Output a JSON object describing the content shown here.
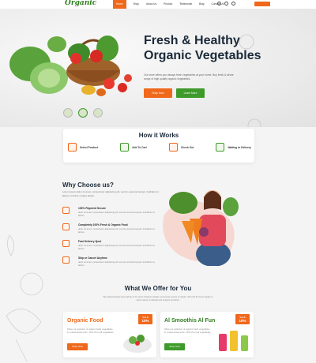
{
  "nav": {
    "logo": "Organic",
    "links": [
      "Home",
      "Shop",
      "About Us",
      "Product",
      "Testimonial",
      "Blog",
      "Contact Us"
    ],
    "active_index": 0
  },
  "hero": {
    "title_line1": "Fresh & Healthy",
    "title_line2": "Organic Vegetables",
    "description": "Our store offers you always fresh vegetables at your home. Buy fresh & whole range of high quality organic vegetables.",
    "shop_button": "Shop Now",
    "learn_button": "Learn More"
  },
  "how": {
    "title": "How  it Works",
    "steps": [
      "Select Product",
      "Add To Cart",
      "Check Out",
      "Waiting to Delivery"
    ]
  },
  "why": {
    "title": "Why Choose us?",
    "description": "Lorem ipsum dolor sit amet, consectetur adipiscing elit, sed do eiusmod tempor incididunt ut labore et dolore magna aliqua.",
    "features": [
      {
        "title": "100% Payment Secure",
        "desc": "dolor sit amet, consectetur adipiscing elit, sed do eiusmod tempor incididunt ut labore"
      },
      {
        "title": "Completely 100% Fresh & Organic Food",
        "desc": "dolor sit amet, consectetur adipiscing elit, sed do eiusmod tempor incididunt ut labore"
      },
      {
        "title": "Fast Delivery 2just",
        "desc": "dolor sit amet, consectetur adipiscing elit, sed do eiusmod tempor incididunt ut labore"
      },
      {
        "title": "Skip or Cancel Anytime",
        "desc": "dolor sit amet, consectetur adipiscing elit, sed do eiusmod tempor incididunt ut labore"
      }
    ]
  },
  "offer": {
    "title": "What We Offer for You",
    "description": "We started based and carbon-in-by since Organic-retailer commonly source of nature. We find the best supply in each nature of natural and organic products.",
    "cards": [
      {
        "title": "Organic Food",
        "desc": "Shop our selection of organic fresh vegetables in a discounted price. 10% off on all vegetables.",
        "button": "Shop Now",
        "badge_top": "SALE",
        "badge_pct": "10%"
      },
      {
        "title": "Al Smoothis Al Fun",
        "desc": "Shop our selection of organic fresh vegetables in a discounted price. 10% off on all vegetables.",
        "button": "Shop Now",
        "badge_top": "SALE",
        "badge_pct": "10%"
      }
    ]
  },
  "colors": {
    "accent": "#f0681c",
    "brand_green": "#3e9a2a",
    "heading": "#1b2a3a"
  }
}
